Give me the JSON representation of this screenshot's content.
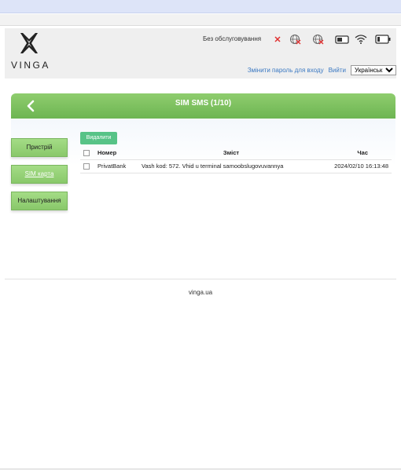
{
  "brand": {
    "logo_text": "VINGA"
  },
  "status": {
    "service_text": "Без обслуговування",
    "icons": [
      "x-mark-icon",
      "globe-disabled-icon",
      "roaming-disabled-icon",
      "sim-card-icon",
      "wifi-icon",
      "battery-icon"
    ]
  },
  "header_links": {
    "change_password": "Змінити пароль для входу",
    "logout": "Вийти"
  },
  "language": {
    "selected": "Українська"
  },
  "panel": {
    "title": "SIM SMS (1/10)"
  },
  "sidebar": {
    "items": [
      {
        "label": "Пристрій"
      },
      {
        "label": "SIM карта",
        "active": true
      },
      {
        "label": "Налаштування"
      }
    ]
  },
  "toolbar": {
    "delete_label": "Видалити"
  },
  "table": {
    "columns": [
      "Номер",
      "Зміст",
      "Час"
    ],
    "rows": [
      {
        "number": "PrivatBank",
        "content": "Vash kod: 572. Vhid u terminal samoobslugovuvannya",
        "time": "2024/02/10 16:13:48"
      }
    ]
  },
  "footer": {
    "text": "vinga.ua"
  },
  "colors": {
    "accent_green": "#6db552",
    "button_green": "#57c387",
    "link_blue": "#3a78c2"
  }
}
